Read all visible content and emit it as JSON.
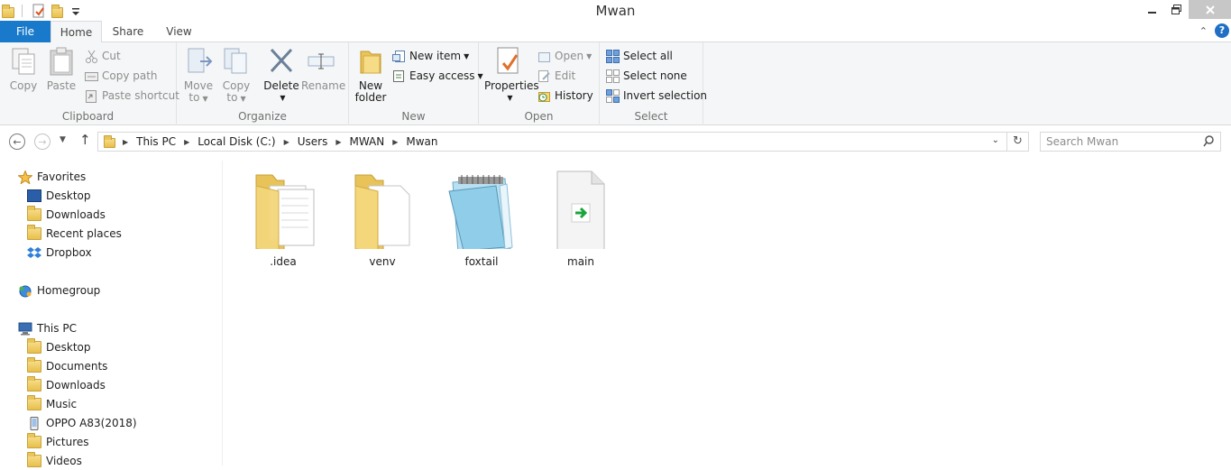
{
  "window": {
    "title": "Mwan"
  },
  "quick_access": [
    "folder-icon",
    "properties-icon",
    "new-folder-icon",
    "customize-qat-icon"
  ],
  "tabs": [
    {
      "label": "File"
    },
    {
      "label": "Home"
    },
    {
      "label": "Share"
    },
    {
      "label": "View"
    }
  ],
  "ribbon": {
    "clipboard": {
      "label": "Clipboard",
      "copy": "Copy",
      "paste": "Paste",
      "cut": "Cut",
      "copy_path": "Copy path",
      "paste_shortcut": "Paste shortcut"
    },
    "organize": {
      "label": "Organize",
      "move_to": "Move",
      "move_to_2": "to",
      "copy_to": "Copy",
      "copy_to_2": "to",
      "delete": "Delete",
      "rename": "Rename"
    },
    "new": {
      "label": "New",
      "new_folder": "New",
      "new_folder_2": "folder",
      "new_item": "New item",
      "easy_access": "Easy access"
    },
    "open": {
      "label": "Open",
      "properties": "Properties",
      "open": "Open",
      "edit": "Edit",
      "history": "History"
    },
    "select": {
      "label": "Select",
      "select_all": "Select all",
      "select_none": "Select none",
      "invert_selection": "Invert selection"
    }
  },
  "address": {
    "crumbs": [
      "This PC",
      "Local Disk (C:)",
      "Users",
      "MWAN",
      "Mwan"
    ],
    "search_placeholder": "Search Mwan"
  },
  "nav": {
    "favorites": "Favorites",
    "favorites_items": [
      "Desktop",
      "Downloads",
      "Recent places",
      "Dropbox"
    ],
    "homegroup": "Homegroup",
    "this_pc": "This PC",
    "this_pc_items": [
      "Desktop",
      "Documents",
      "Downloads",
      "Music",
      "OPPO A83(2018)",
      "Pictures",
      "Videos"
    ]
  },
  "files": [
    {
      "name": ".idea",
      "type": "folder-with-files"
    },
    {
      "name": "venv",
      "type": "folder"
    },
    {
      "name": "foxtail",
      "type": "notepad-file"
    },
    {
      "name": "main",
      "type": "python-shortcut-file"
    }
  ],
  "colors": {
    "file_tab": "#1979ca",
    "ribbon_bg": "#f5f6f7",
    "folder": "#f2d073",
    "close_btn": "#c7c7c7"
  }
}
